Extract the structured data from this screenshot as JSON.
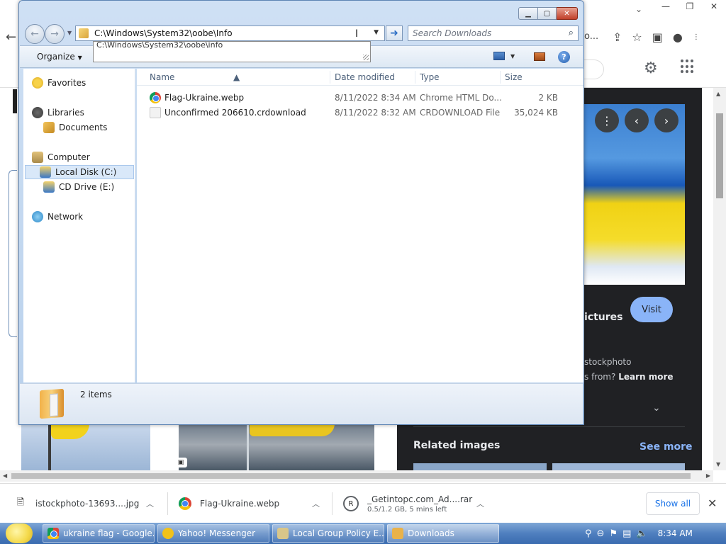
{
  "browser": {
    "omnibox_partial": "o...",
    "panel": {
      "title_fragment": "ictures",
      "visit_label": "Visit",
      "source_text": "stockphoto",
      "source_question": "s from?",
      "learn_more": "Learn more",
      "related_images": "Related images",
      "see_more": "See more"
    }
  },
  "downloads": {
    "items": [
      {
        "name": "istockphoto-13693....jpg"
      },
      {
        "name": "Flag-Ukraine.webp"
      },
      {
        "name": "_Getintopc.com_Ad....rar",
        "status": "0.5/1.2 GB, 5 mins left"
      }
    ],
    "show_all": "Show all"
  },
  "taskbar": {
    "buttons": [
      {
        "label": "ukraine flag - Google..."
      },
      {
        "label": "Yahoo! Messenger"
      },
      {
        "label": "Local Group Policy E..."
      },
      {
        "label": "Downloads"
      }
    ],
    "clock": "8:34 AM"
  },
  "explorer": {
    "address": "C:\\Windows\\System32\\oobe\\Info",
    "autocomplete": "C:\\Windows\\System32\\oobe\\info",
    "search_placeholder": "Search Downloads",
    "organize": "Organize",
    "nav": {
      "favorites": "Favorites",
      "libraries": "Libraries",
      "documents": "Documents",
      "computer": "Computer",
      "local_disk": "Local Disk (C:)",
      "cd_drive": "CD Drive (E:)",
      "network": "Network"
    },
    "columns": {
      "name": "Name",
      "date": "Date modified",
      "type": "Type",
      "size": "Size"
    },
    "files": [
      {
        "name": "Flag-Ukraine.webp",
        "date": "8/11/2022 8:34 AM",
        "type": "Chrome HTML Do...",
        "size": "2 KB"
      },
      {
        "name": "Unconfirmed 206610.crdownload",
        "date": "8/11/2022 8:32 AM",
        "type": "CRDOWNLOAD File",
        "size": "35,024 KB"
      }
    ],
    "item_count": "2 items"
  }
}
